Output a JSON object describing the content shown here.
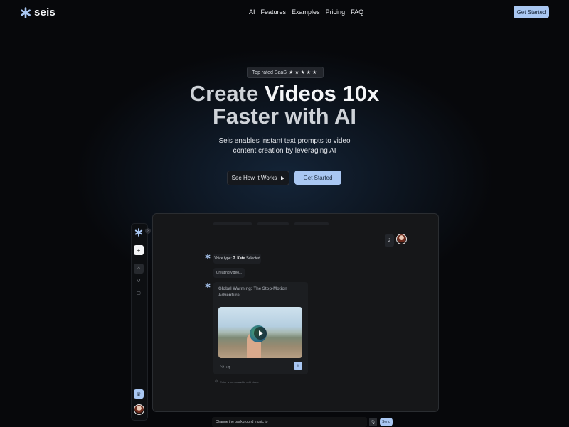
{
  "brand": {
    "name": "seis",
    "accent": "#a9c7f2"
  },
  "nav": {
    "links": [
      "AI",
      "Features",
      "Examples",
      "Pricing",
      "FAQ"
    ],
    "cta_label": "Get Started"
  },
  "hero": {
    "badge_text": "Top rated SaaS",
    "badge_stars": "★★★★★",
    "title_dim_1": "Create ",
    "title_bright_1": "Videos 10x",
    "title_line_2": "Faster with AI",
    "subtitle": "Seis enables instant text prompts to video content creation by leveraging AI",
    "secondary_button": "See How It Works",
    "primary_button": "Get Started"
  },
  "app": {
    "sidebar": {
      "collapse_icon": "chevron-right-icon",
      "new_icon": "plus-icon",
      "nav_icons": [
        "home-icon",
        "history-icon",
        "chat-icon"
      ],
      "upgrade_icon": "crown-icon"
    },
    "user_message": "2",
    "voice_chip": {
      "prefix": "Voice type:",
      "value": "2. Kate",
      "suffix": "Selected"
    },
    "creating_text": "Creating video...",
    "video_card": {
      "title": "Global Warming: The Stop-Motion Adventure!"
    },
    "edit_hint": "Enter a command to edit video",
    "prompt": {
      "value": "Change the background music to",
      "send_label": "Send"
    }
  }
}
